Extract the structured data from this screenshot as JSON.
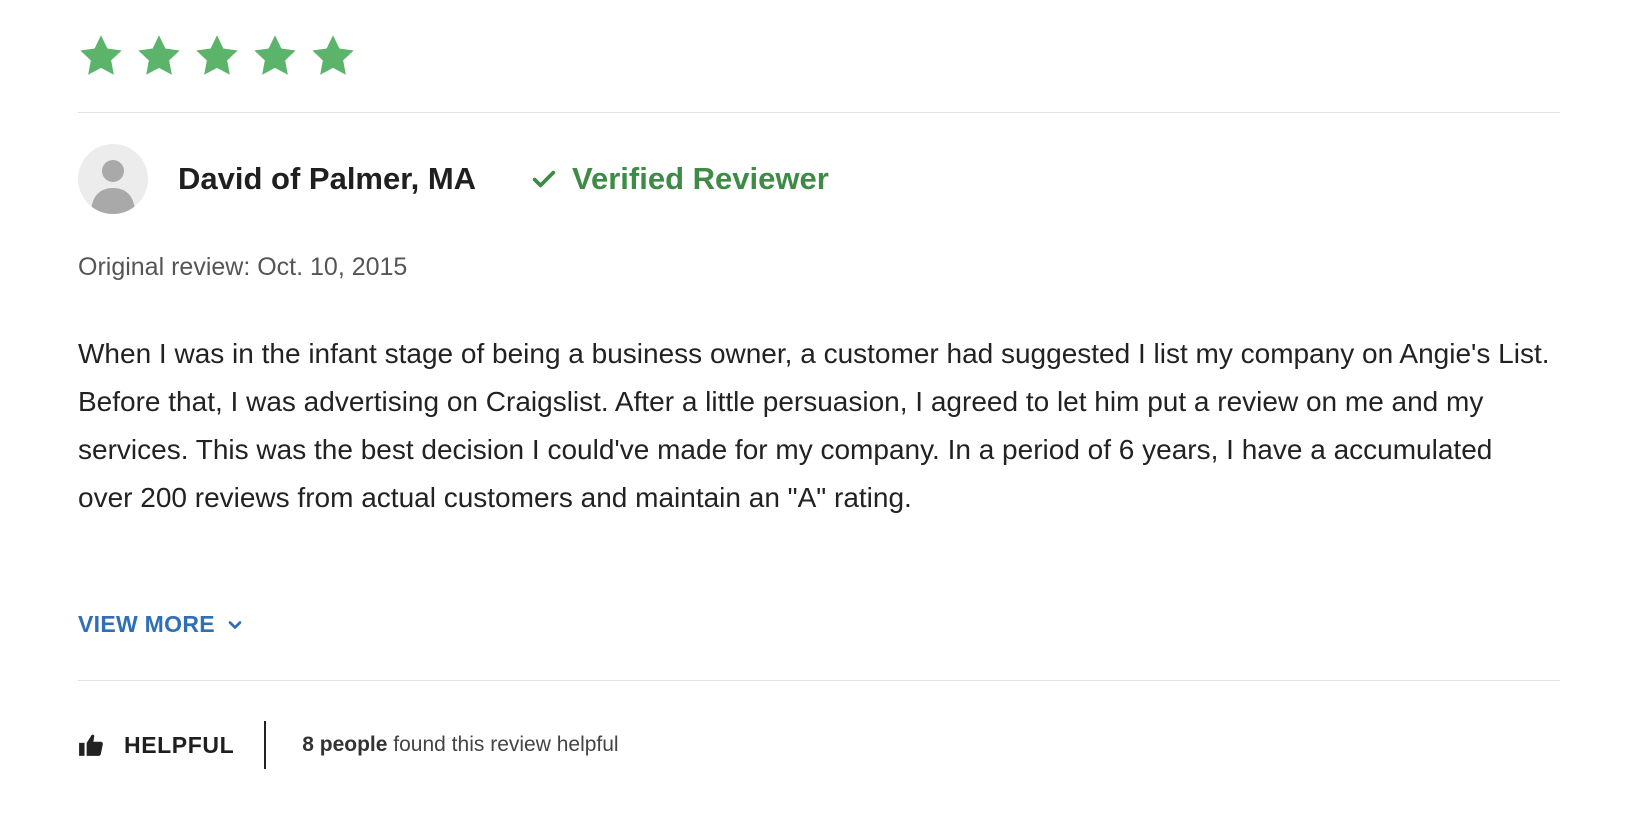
{
  "rating": {
    "value": 5,
    "max": 5,
    "color": "#5cb36a"
  },
  "reviewer": {
    "name": "David of Palmer, MA",
    "avatar_icon": "user-silhouette-icon",
    "verified_icon": "check-icon",
    "verified_label": "Verified Reviewer",
    "verified_color": "#3d8b45"
  },
  "review": {
    "date": "Original review: Oct. 10, 2015",
    "body": "When I was in the infant stage of being a business owner, a customer had suggested I list my company on Angie's List. Before that, I was advertising on Craigslist. After a little persuasion, I agreed to let him put a review on me and my services. This was the best decision I could've made for my company. In a period of 6 years, I have a accumulated over 200 reviews from actual customers and maintain an \"A\" rating.",
    "view_more_label": "VIEW MORE",
    "view_more_icon": "chevron-down-icon",
    "link_color": "#2f6fb5"
  },
  "helpful": {
    "icon": "thumbs-up-icon",
    "label": "HELPFUL",
    "count_strong": "8 people",
    "count_rest": "found this review helpful"
  }
}
